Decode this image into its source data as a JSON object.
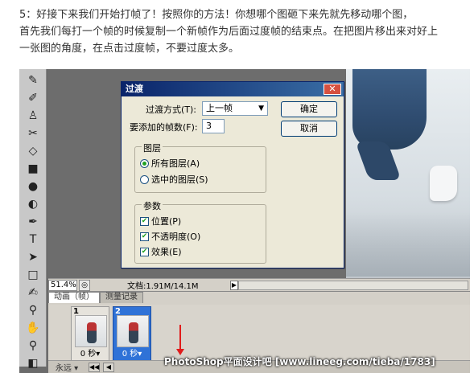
{
  "article": {
    "line1": "5：好接下来我们开始打帧了！按照你的方法！你想哪个图砸下来先就先移动哪个图，",
    "line2": "首先我们每打一个帧的时候复制一个新帧作为后面过度帧的结束点。在把图片移出来对好上",
    "line3": "一张图的角度，在点击过度帧，不要过度太多。"
  },
  "dialog": {
    "title": "过渡",
    "method_label": "过渡方式(T):",
    "method_value": "上一帧",
    "frames_label": "要添加的帧数(F):",
    "frames_value": "3",
    "ok_label": "确定",
    "cancel_label": "取消",
    "layers_group": "图层",
    "layer_all": "所有图层(A)",
    "layer_selected": "选中的图层(S)",
    "params_group": "参数",
    "param_position": "位置(P)",
    "param_opacity": "不透明度(O)",
    "param_effects": "效果(E)"
  },
  "status": {
    "zoom": "51.4%",
    "doc": "文档:1.91M/14.1M"
  },
  "animation": {
    "tabs": [
      "动画（帧）",
      "测量记录"
    ],
    "frames": [
      {
        "num": "1",
        "time": "0 秒▾",
        "selected": false
      },
      {
        "num": "2",
        "time": "0 秒▾",
        "selected": true
      }
    ],
    "loop": "永远 ▾"
  },
  "watermark": "PhotoShop平面设计吧 [www.lineeg.com/tieba/1783]",
  "tool_icons": [
    "brush-icon",
    "pencil-icon",
    "stamp-icon",
    "history-brush-icon",
    "eraser-icon",
    "gradient-icon",
    "blur-icon",
    "dodge-icon",
    "pen-icon",
    "type-icon",
    "path-select-icon",
    "shape-icon",
    "notes-icon",
    "eyedropper-icon",
    "hand-icon",
    "zoom-icon",
    "color-swatch-icon"
  ],
  "colors": {
    "title_bar": "#0a246a",
    "selected_frame": "#2f72d7",
    "arrow": "#e01b1b"
  }
}
